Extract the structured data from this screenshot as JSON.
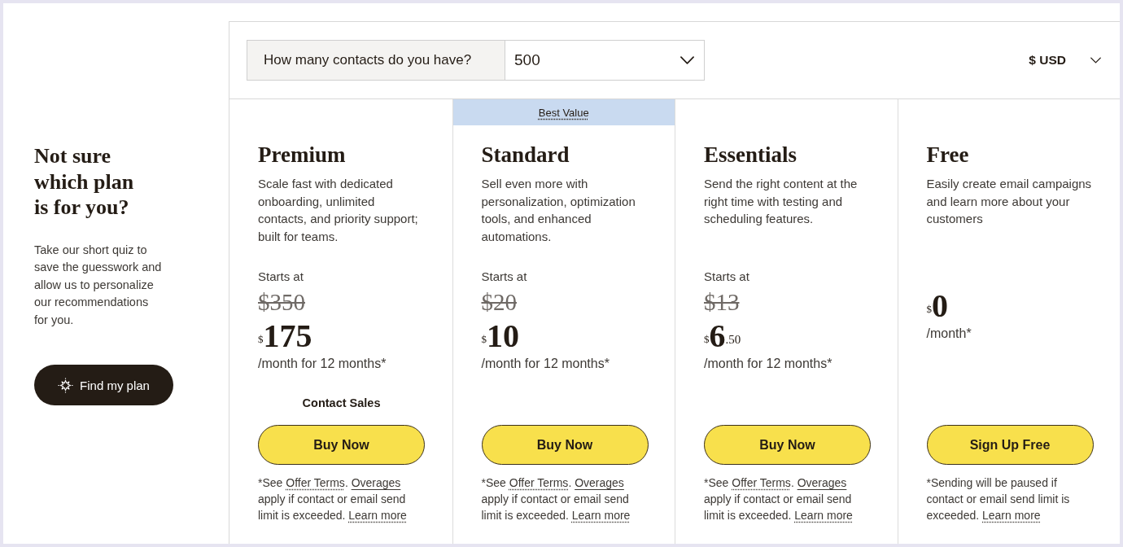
{
  "sidebar": {
    "heading": "Not sure which plan is for you?",
    "text": "Take our short quiz to save the guesswork and allow us to personalize our recommendations for you.",
    "button": "Find my plan"
  },
  "contacts_select": {
    "label": "How many contacts do you have?",
    "value": "500"
  },
  "currency_select": {
    "value": "$ USD"
  },
  "plans": [
    {
      "name": "Premium",
      "description": "Scale fast with dedicated onboarding, unlimited contacts, and priority support; built for teams.",
      "starts_label": "Starts at",
      "old_price": "$350",
      "price": {
        "currency": "$",
        "amount": "175"
      },
      "period": "/month for 12 months*",
      "contact_link": "Contact Sales",
      "button": "Buy Now",
      "footnote": [
        {
          "kind": "text",
          "text": "*See "
        },
        {
          "kind": "link",
          "text": "Offer Terms",
          "dotted_underline": true
        },
        {
          "kind": "text",
          "text": ". "
        },
        {
          "kind": "link",
          "text": "Overages",
          "dotted_underline": false
        },
        {
          "kind": "text",
          "text": " apply if contact or email send limit is exceeded. "
        },
        {
          "kind": "link",
          "text": "Learn more",
          "dotted_underline": true
        }
      ]
    },
    {
      "name": "Standard",
      "badge": "Best Value",
      "description": "Sell even more with personalization, optimization tools, and enhanced automations.",
      "starts_label": "Starts at",
      "old_price": "$20",
      "price": {
        "currency": "$",
        "amount": "10"
      },
      "period": "/month for 12 months*",
      "button": "Buy Now",
      "footnote": [
        {
          "kind": "text",
          "text": "*See "
        },
        {
          "kind": "link",
          "text": "Offer Terms",
          "dotted_underline": true
        },
        {
          "kind": "text",
          "text": ". "
        },
        {
          "kind": "link",
          "text": "Overages",
          "dotted_underline": false
        },
        {
          "kind": "text",
          "text": " apply if contact or email send limit is exceeded. "
        },
        {
          "kind": "link",
          "text": "Learn more",
          "dotted_underline": true
        }
      ]
    },
    {
      "name": "Essentials",
      "description": "Send the right content at the right time with testing and scheduling features.",
      "starts_label": "Starts at",
      "old_price": "$13",
      "price": {
        "currency": "$",
        "amount": "6",
        "cents": ".50"
      },
      "period": "/month for 12 months*",
      "button": "Buy Now",
      "footnote": [
        {
          "kind": "text",
          "text": "*See "
        },
        {
          "kind": "link",
          "text": "Offer Terms",
          "dotted_underline": true
        },
        {
          "kind": "text",
          "text": ". "
        },
        {
          "kind": "link",
          "text": "Overages",
          "dotted_underline": false
        },
        {
          "kind": "text",
          "text": " apply if contact or email send limit is exceeded. "
        },
        {
          "kind": "link",
          "text": "Learn more",
          "dotted_underline": true
        }
      ]
    },
    {
      "name": "Free",
      "description": "Easily create email campaigns and learn more about your customers",
      "price": {
        "currency": "$",
        "amount": "0"
      },
      "period": "/month*",
      "button": "Sign Up Free",
      "footnote": [
        {
          "kind": "text",
          "text": "*Sending will be paused if contact or email send limit is exceeded. "
        },
        {
          "kind": "link",
          "text": "Learn more",
          "dotted_underline": true
        }
      ]
    }
  ]
}
